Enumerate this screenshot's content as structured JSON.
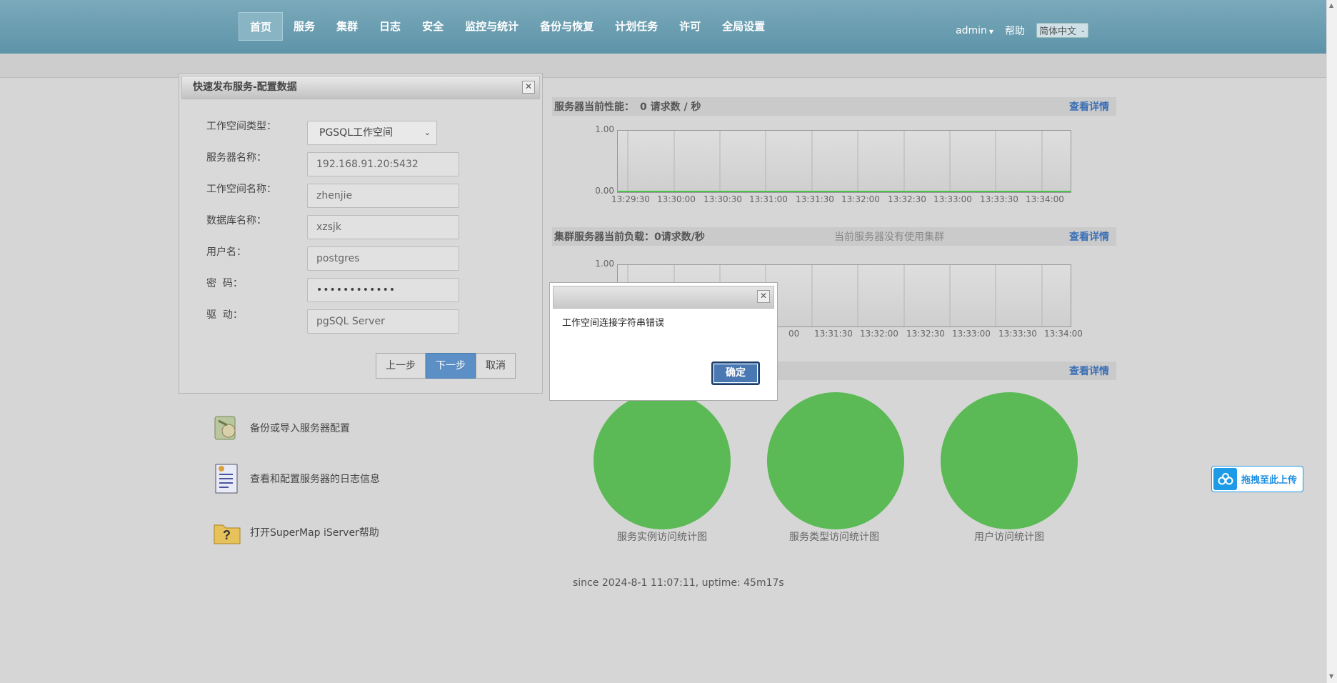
{
  "nav": {
    "items": [
      "首页",
      "服务",
      "集群",
      "日志",
      "安全",
      "监控与统计",
      "备份与恢复",
      "计划任务",
      "许可",
      "全局设置"
    ],
    "active_index": 0
  },
  "user": {
    "name": "admin",
    "help": "帮助",
    "language": "简体中文"
  },
  "performance": {
    "title": "服务器当前性能：",
    "value": "0 请求数 / 秒",
    "detail": "查看详情",
    "y_max": "1.00",
    "y_min": "0.00",
    "times": [
      "13:29:30",
      "13:30:00",
      "13:30:30",
      "13:31:00",
      "13:31:30",
      "13:32:00",
      "13:32:30",
      "13:33:00",
      "13:33:30",
      "13:34:00"
    ]
  },
  "cluster": {
    "title": "集群服务器当前负载：",
    "value": "0请求数/秒",
    "note": "当前服务器没有使用集群",
    "detail": "查看详情",
    "y_max": "1.00",
    "times_visible": [
      "00",
      "13:31:30",
      "13:32:00",
      "13:32:30",
      "13:33:00",
      "13:33:30",
      "13:34:00"
    ]
  },
  "stats": {
    "detail": "查看详情"
  },
  "pies": [
    {
      "label": "服务实例访问统计图"
    },
    {
      "label": "服务类型访问统计图"
    },
    {
      "label": "用户访问统计图"
    }
  ],
  "quick_links": [
    {
      "label": "备份或导入服务器配置",
      "icon": "backup-config-icon"
    },
    {
      "label": "查看和配置服务器的日志信息",
      "icon": "log-document-icon"
    },
    {
      "label": "打开SuperMap iServer帮助",
      "icon": "help-folder-icon"
    }
  ],
  "uptime": "since 2024-8-1 11:07:11, uptime: 45m17s",
  "wizard": {
    "title": "快速发布服务-配置数据",
    "fields": [
      {
        "label": "工作空间类型：",
        "value": "PGSQL工作空间",
        "type": "select"
      },
      {
        "label": "服务器名称：",
        "value": "192.168.91.20:5432"
      },
      {
        "label": "工作空间名称：",
        "value": "zhenjie"
      },
      {
        "label": "数据库名称：",
        "value": "xzsjk"
      },
      {
        "label": "用户名：",
        "value": "postgres"
      },
      {
        "label": "密  码：",
        "value": "••••••••••••"
      },
      {
        "label": "驱  动：",
        "value": "pgSQL Server"
      }
    ],
    "prev": "上一步",
    "next": "下一步",
    "cancel": "取消"
  },
  "alert": {
    "message": "工作空间连接字符串错误",
    "ok": "确定"
  },
  "upload": {
    "label": "拖拽至此上传"
  },
  "colors": {
    "nav": "#6a9db0",
    "pie": "#5bba55",
    "primary_button": "#5b8fc5",
    "link": "#3a6fb5",
    "upload": "#1e9be6"
  }
}
